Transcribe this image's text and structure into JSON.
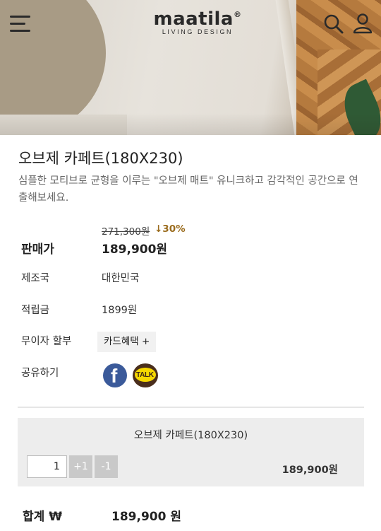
{
  "header": {
    "logo_word": "maatila",
    "logo_reg": "®",
    "logo_sub": "LIVING DESIGN",
    "icons": {
      "menu": "hamburger-menu-icon",
      "search": "search-icon",
      "account": "user-icon"
    }
  },
  "product": {
    "title": "오브제 카페트(180X230)",
    "description": "심플한 모티브로 균형을 이루는 \"오브제 매트\" 유니크하고 감각적인 공간으로 연출해보세요."
  },
  "pricing": {
    "original_price": "271,300원",
    "discount": "↓30%",
    "price_label": "판매가",
    "price": "189,900원"
  },
  "details": {
    "origin_label": "제조국",
    "origin_value": "대한민국",
    "points_label": "적립금",
    "points_value": "1899원",
    "installment_label": "무이자 할부",
    "card_benefit_button": "카드혜택 +",
    "share_label": "공유하기",
    "share_icons": [
      "facebook-icon",
      "kakaotalk-icon"
    ],
    "talk_text": "TALK",
    "facebook_letter": "f"
  },
  "option": {
    "name": "오브제 카페트(180X230)",
    "quantity": "1",
    "plus_label": "+1",
    "minus_label": "-1",
    "price": "189,900원"
  },
  "total": {
    "label": "합계 ₩",
    "value": "189,900 원"
  },
  "colors": {
    "discount": "#9a6b1c",
    "facebook": "#3b5a9a",
    "kakao_yellow": "#f6d800",
    "qty_button": "#c9c9c9"
  }
}
